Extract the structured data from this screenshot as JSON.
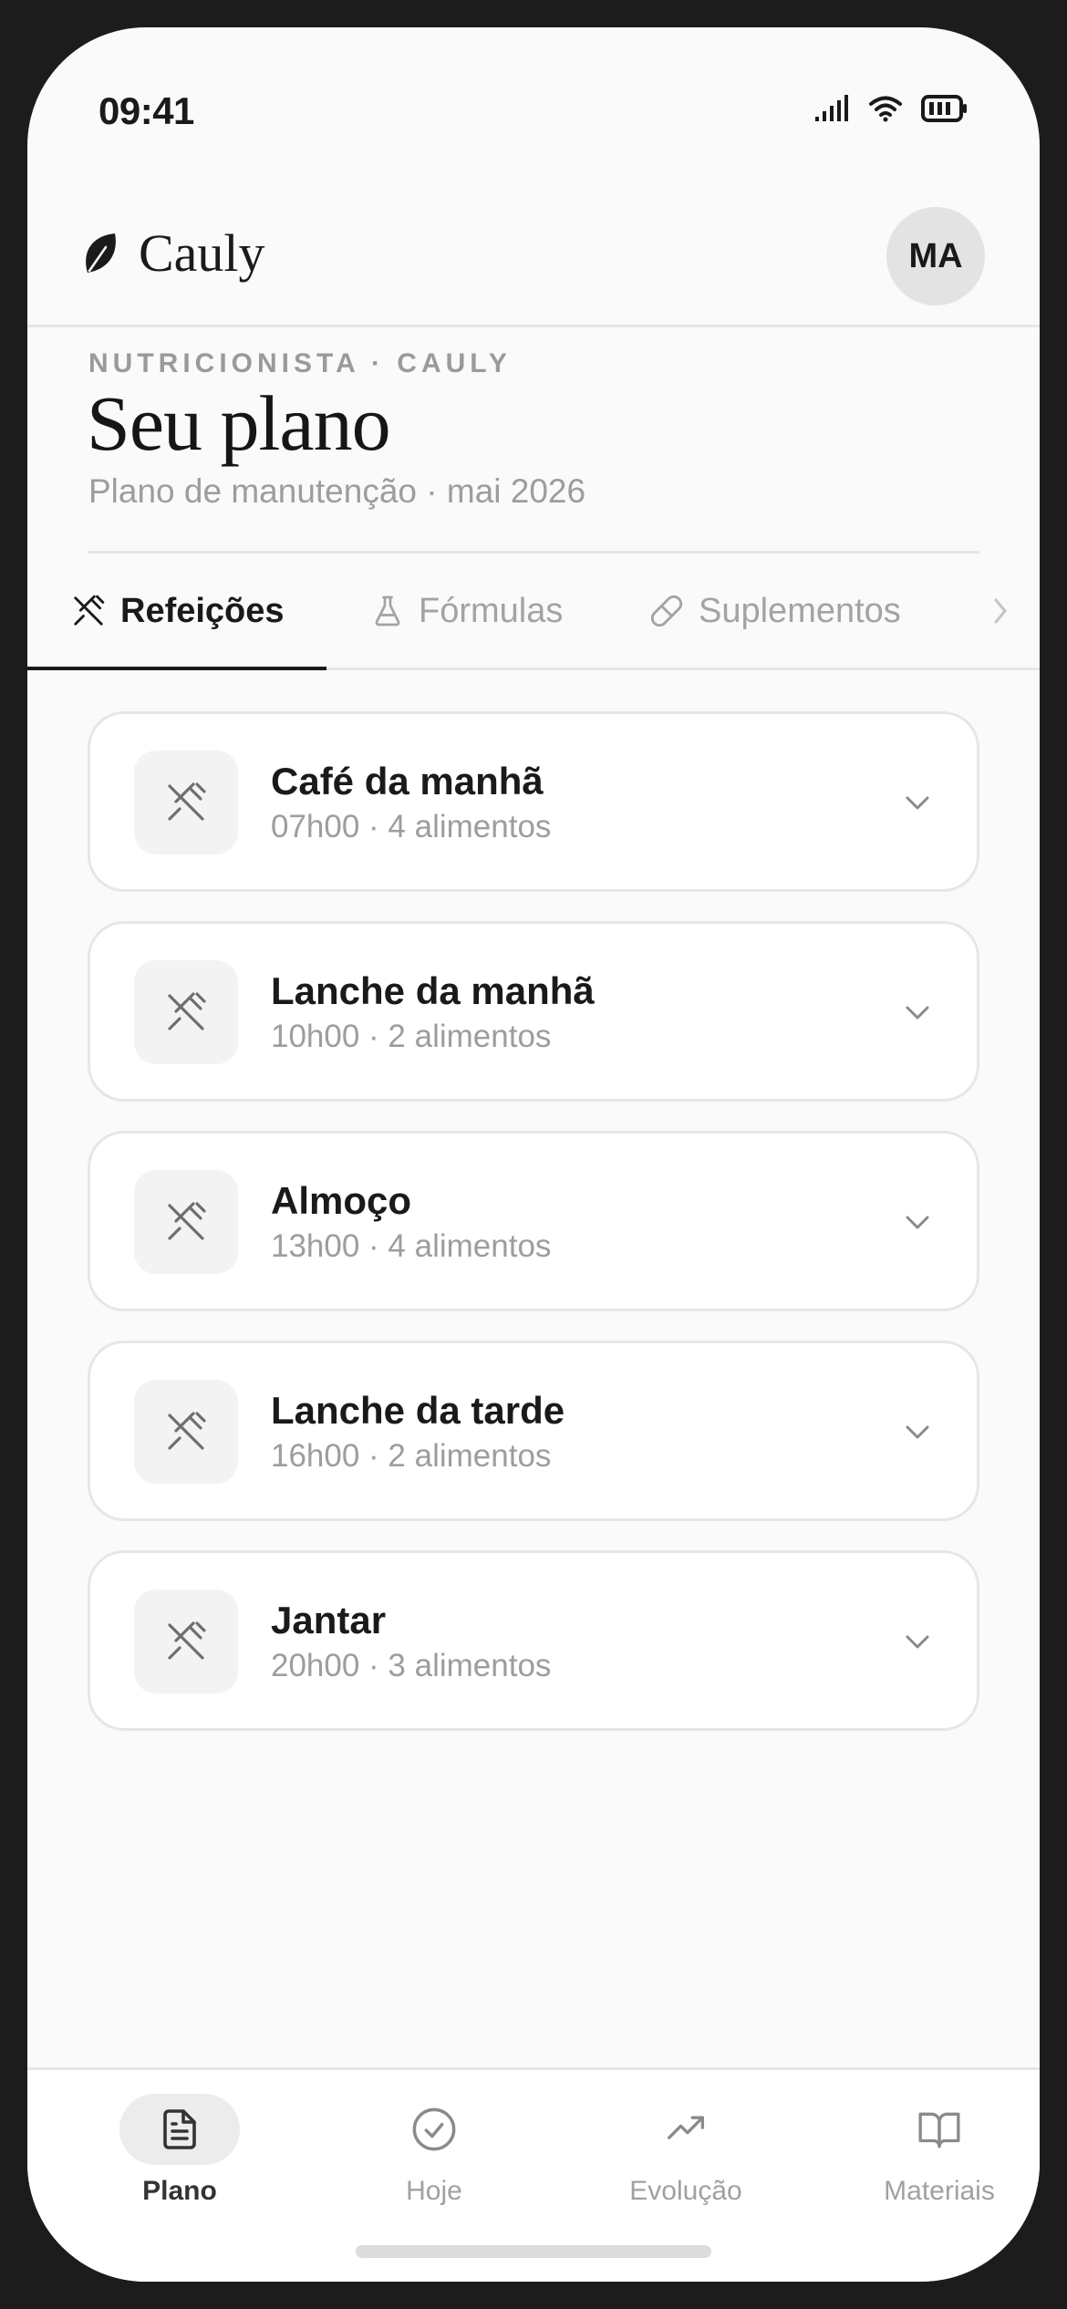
{
  "status_bar": {
    "time": "09:41"
  },
  "app": {
    "brand": "Cauly",
    "avatar_initials": "MA"
  },
  "heading": {
    "eyebrow": "NUTRICIONISTA · CAULY",
    "title": "Seu plano",
    "subtitle": "Plano de manutenção · mai 2026"
  },
  "tabs": [
    {
      "label": "Refeições",
      "icon": "utensils-crossed-icon",
      "active": true
    },
    {
      "label": "Fórmulas",
      "icon": "flask-icon",
      "active": false
    },
    {
      "label": "Suplementos",
      "icon": "pill-icon",
      "active": false
    }
  ],
  "meals": [
    {
      "name": "Café da manhã",
      "meta": "07h00 · 4 alimentos"
    },
    {
      "name": "Lanche da manhã",
      "meta": "10h00 · 2 alimentos"
    },
    {
      "name": "Almoço",
      "meta": "13h00 · 4 alimentos"
    },
    {
      "name": "Lanche da tarde",
      "meta": "16h00 · 2 alimentos"
    },
    {
      "name": "Jantar",
      "meta": "20h00 · 3 alimentos"
    }
  ],
  "bottom_nav": [
    {
      "label": "Plano",
      "icon": "document-icon",
      "active": true
    },
    {
      "label": "Hoje",
      "icon": "check-circle-icon",
      "active": false
    },
    {
      "label": "Evolução",
      "icon": "trending-up-icon",
      "active": false
    },
    {
      "label": "Materiais",
      "icon": "book-open-icon",
      "active": false
    }
  ],
  "colors": {
    "accent": "#1a1a1a",
    "muted": "#9d9d9d",
    "border": "#e6e6e6"
  }
}
